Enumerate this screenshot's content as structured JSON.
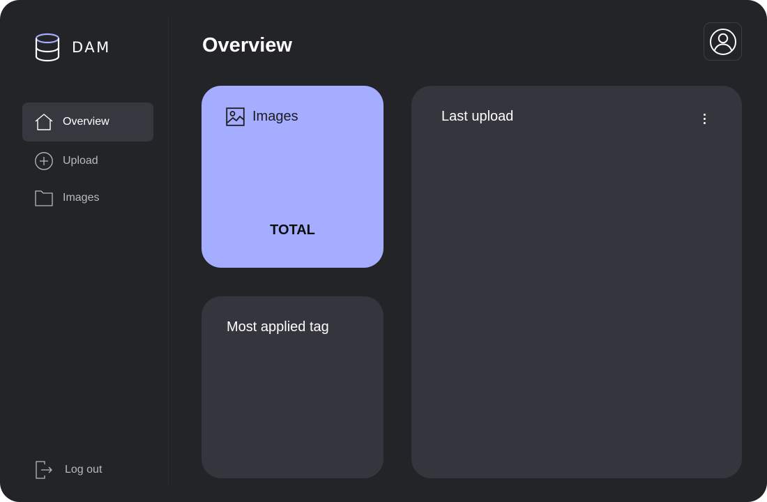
{
  "brand": {
    "name": "DAM",
    "icon": "database-icon",
    "accent": "#a4adff"
  },
  "sidebar": {
    "items": [
      {
        "label": "Overview",
        "icon": "home-icon",
        "active": true
      },
      {
        "label": "Upload",
        "icon": "plus-circle-icon",
        "active": false
      },
      {
        "label": "Images",
        "icon": "folder-icon",
        "active": false
      }
    ],
    "logout": {
      "label": "Log out",
      "icon": "logout-icon"
    }
  },
  "header": {
    "title": "Overview",
    "profile_icon": "user-circle-icon"
  },
  "cards": {
    "images": {
      "label": "Images",
      "icon": "image-icon",
      "total_label": "TOTAL",
      "background": "#a4adff"
    },
    "tag": {
      "title": "Most applied tag"
    },
    "last_upload": {
      "title": "Last upload",
      "menu_icon": "more-vertical-icon"
    }
  },
  "colors": {
    "app_background": "#232428",
    "card_background": "#34353d",
    "active_nav": "#36373f"
  }
}
